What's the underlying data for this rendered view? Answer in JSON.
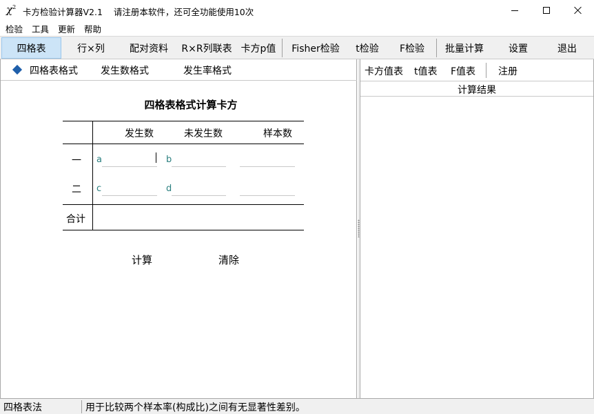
{
  "window": {
    "icon_symbol": "χ",
    "icon_superscript": "2",
    "title": "卡方检验计算器V2.1    请注册本软件，还可全功能使用10次"
  },
  "menu": [
    "检验",
    "工具",
    "更新",
    "帮助"
  ],
  "toolbar": {
    "active": "四格表",
    "buttons": [
      "四格表",
      "行×列",
      "配对资料",
      "R×R列联表",
      "卡方p值",
      "Fisher检验",
      "t检验",
      "F检验",
      "批量计算",
      "设置",
      "退出"
    ]
  },
  "left_tabs": [
    "四格表格式",
    "发生数格式",
    "发生率格式"
  ],
  "form": {
    "title": "四格表格式计算卡方",
    "columns": [
      "发生数",
      "未发生数",
      "样本数"
    ],
    "rows": [
      "一",
      "二"
    ],
    "total_label": "合计",
    "cell_letters": [
      "a",
      "b",
      "c",
      "d"
    ],
    "compute_label": "计算",
    "clear_label": "清除"
  },
  "right_tabs": [
    "卡方值表",
    "t值表",
    "F值表",
    "注册"
  ],
  "result_header": "计算结果",
  "status": {
    "mode": "四格表法",
    "description": "用于比较两个样本率(构成比)之间有无显著性差别。"
  },
  "colors": {
    "toolbar_active": "#cce4f7",
    "diamond": "#1f5faa",
    "cell_letter": "#2a7f7f"
  }
}
